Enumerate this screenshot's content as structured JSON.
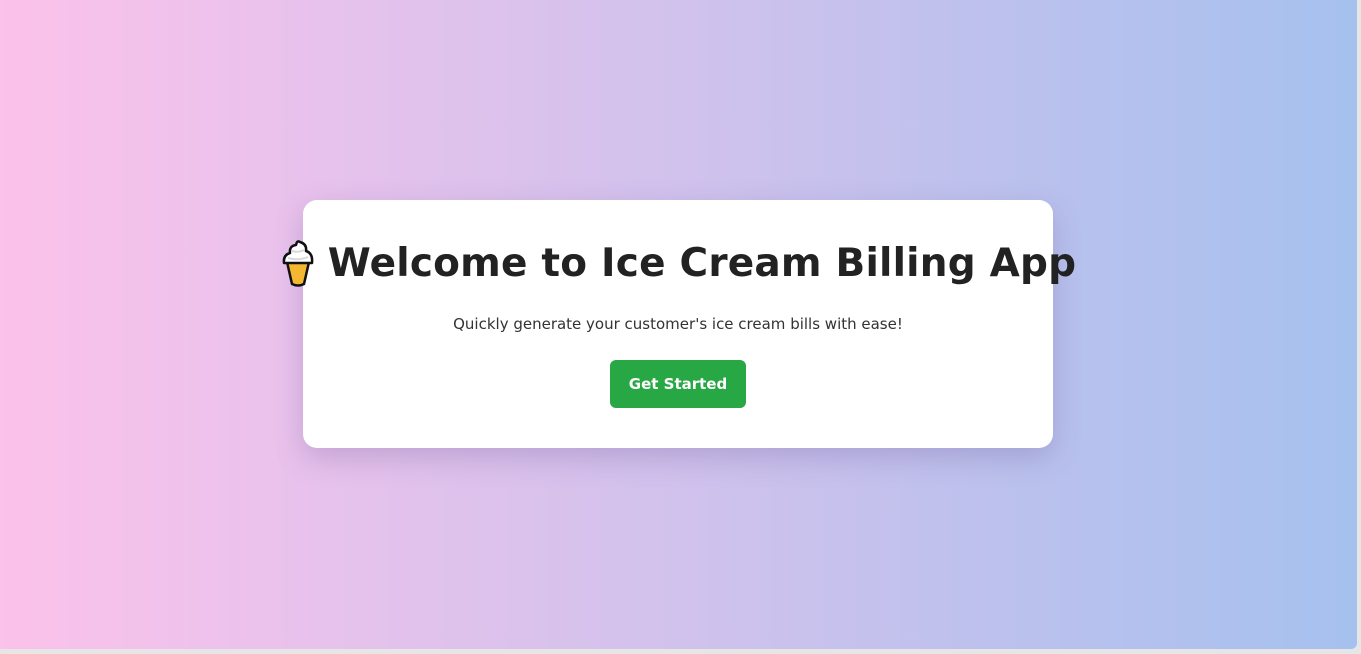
{
  "page": {
    "background_gradient": [
      "#fbc2eb",
      "#a6c1ee"
    ]
  },
  "card": {
    "icon": "ice-cream-cone-icon",
    "title": "Welcome to Ice Cream Billing App",
    "subtitle": "Quickly generate your customer's ice cream bills with ease!",
    "button_label": "Get Started",
    "button_color": "#28a745"
  }
}
